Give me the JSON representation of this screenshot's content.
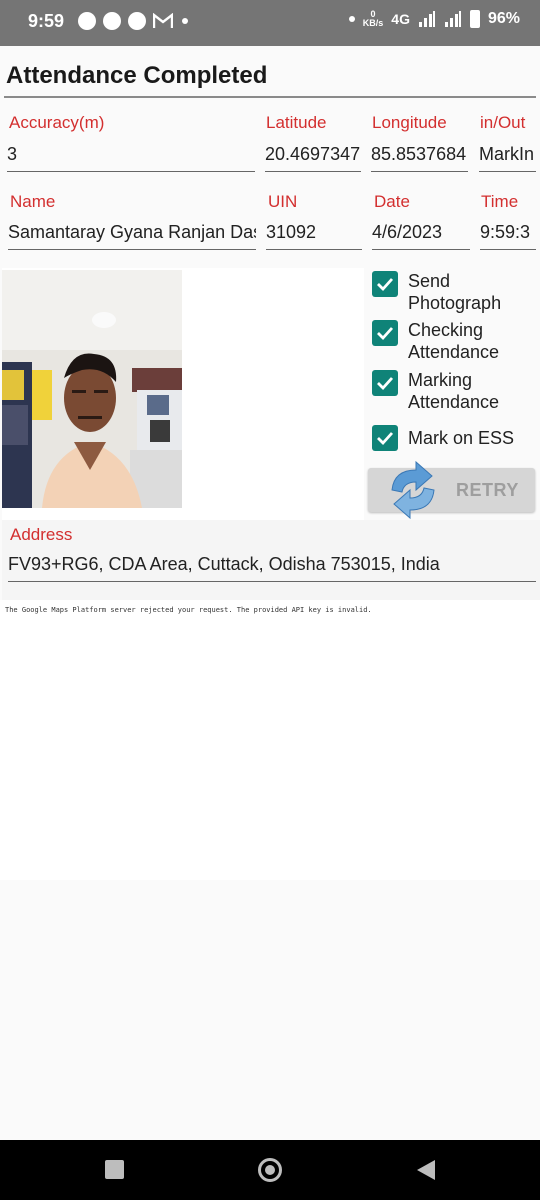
{
  "status_bar": {
    "time": "9:59",
    "network_speed_value": "0",
    "network_speed_unit": "KB/s",
    "network_type": "4G",
    "battery_percent": "96%",
    "icons": [
      "chat-icon",
      "whatsapp-icon",
      "speedometer-icon",
      "gmail-icon",
      "notification-dot-icon",
      "dot-icon",
      "signal-icon",
      "signal-icon",
      "battery-icon"
    ]
  },
  "header": {
    "title": "Attendance Completed"
  },
  "fields_row1": {
    "accuracy": {
      "label": "Accuracy(m)",
      "value": "3"
    },
    "latitude": {
      "label": "Latitude",
      "value": "20.4697347"
    },
    "longitude": {
      "label": "Longitude",
      "value": "85.8537684"
    },
    "in_out": {
      "label": "in/Out",
      "value": "MarkIn"
    }
  },
  "fields_row2": {
    "name": {
      "label": "Name",
      "value": "Samantaray Gyana Ranjan Das"
    },
    "uin": {
      "label": "UIN",
      "value": "31092"
    },
    "date": {
      "label": "Date",
      "value": "4/6/2023"
    },
    "time": {
      "label": "Time",
      "value": "9:59:3"
    }
  },
  "checklist": {
    "items": [
      {
        "label_line1": "Send",
        "label_line2": "Photograph",
        "checked": true
      },
      {
        "label_line1": "Checking",
        "label_line2": "Attendance",
        "checked": true
      },
      {
        "label_line1": "Marking",
        "label_line2": "Attendance",
        "checked": true
      },
      {
        "label_line1": "Mark on ESS",
        "label_line2": "",
        "checked": true
      }
    ]
  },
  "retry_button": {
    "label": "RETRY",
    "icon": "refresh-icon"
  },
  "address": {
    "label": "Address",
    "value": "FV93+RG6, CDA Area, Cuttack, Odisha 753015, India"
  },
  "map": {
    "error_text": "The Google Maps Platform server rejected your request. The provided API key is invalid."
  },
  "colors": {
    "label_red": "#d32f2f",
    "checkbox_teal": "#0f8378",
    "status_bar": "#757575",
    "nav_bar": "#000000"
  }
}
